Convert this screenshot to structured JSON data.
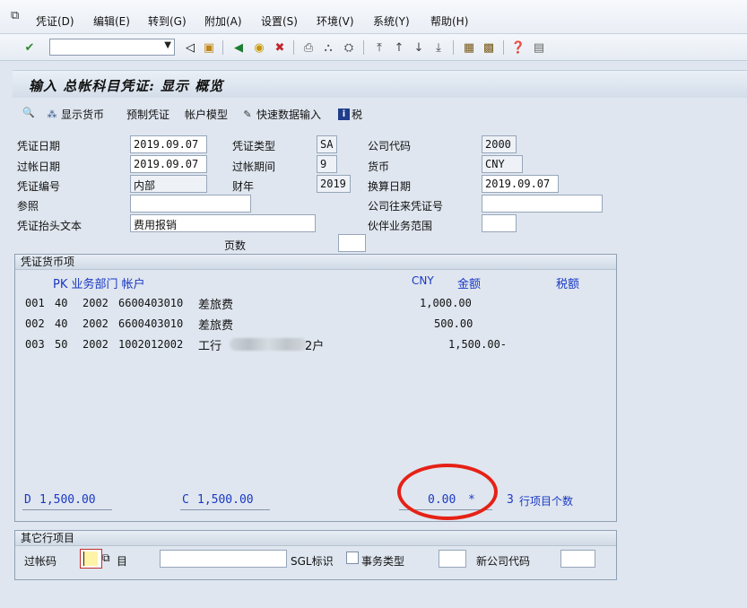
{
  "menu": {
    "items": [
      {
        "label": "凭证(D)"
      },
      {
        "label": "编辑(E)"
      },
      {
        "label": "转到(G)"
      },
      {
        "label": "附加(A)"
      },
      {
        "label": "设置(S)"
      },
      {
        "label": "环境(V)"
      },
      {
        "label": "系统(Y)"
      },
      {
        "label": "帮助(H)"
      }
    ]
  },
  "toolbar": {
    "command_value": ""
  },
  "title": "输入 总帐科目凭证: 显示 概览",
  "app_toolbar": {
    "show_currency": "显示货币",
    "park": "预制凭证",
    "account_model": "帐户模型",
    "fast_entry": "快速数据输入",
    "tax": "税"
  },
  "header": {
    "doc_date_label": "凭证日期",
    "doc_date": "2019.09.07",
    "doc_type_label": "凭证类型",
    "doc_type": "SA",
    "company_code_label": "公司代码",
    "company_code": "2000",
    "posting_date_label": "过帐日期",
    "posting_date": "2019.09.07",
    "period_label": "过帐期间",
    "period": "9",
    "currency_label": "货币",
    "currency": "CNY",
    "doc_number_label": "凭证编号",
    "doc_number": "内部",
    "fiscal_year_label": "财年",
    "fiscal_year": "2019",
    "translation_date_label": "换算日期",
    "translation_date": "2019.09.07",
    "reference_label": "参照",
    "reference": "",
    "intercompany_label": "公司往来凭证号",
    "intercompany": "",
    "header_text_label": "凭证抬头文本",
    "header_text": "费用报销",
    "partner_label": "伙伴业务范围",
    "partner": "",
    "page_label": "页数",
    "page": ""
  },
  "items": {
    "group_title": "凭证货币项",
    "headers": {
      "pk_seg_acct": "PK 业务部门 帐户",
      "currency": "CNY",
      "amount": "金额",
      "tax": "税额"
    },
    "rows": [
      {
        "line": "001",
        "pk": "40",
        "bu": "2002",
        "account": "6600403010",
        "text": "差旅费",
        "suffix": "",
        "amount": "1,000.00"
      },
      {
        "line": "002",
        "pk": "40",
        "bu": "2002",
        "account": "6600403010",
        "text": "差旅费",
        "suffix": "",
        "amount": "500.00"
      },
      {
        "line": "003",
        "pk": "50",
        "bu": "2002",
        "account": "1002012002",
        "text": "工行",
        "suffix": "2户",
        "amount": "1,500.00-"
      }
    ],
    "debit_prefix": "D",
    "debit_total": "1,500.00",
    "credit_prefix": "C",
    "credit_total": "1,500.00",
    "balance": "0.00",
    "balance_marker": "*",
    "item_count": "3",
    "item_count_label": "行项目个数"
  },
  "other_item": {
    "group_title": "其它行项目",
    "posting_key_label": "过帐码",
    "account_label": "目",
    "account_value": "",
    "sgl_label": "SGL标识",
    "txn_type_label": "事务类型",
    "txn_type": "",
    "new_cocode_label": "新公司代码",
    "new_cocode": ""
  },
  "colors": {
    "accent_blue": "#1a38c4",
    "highlight_red": "#e62117"
  }
}
